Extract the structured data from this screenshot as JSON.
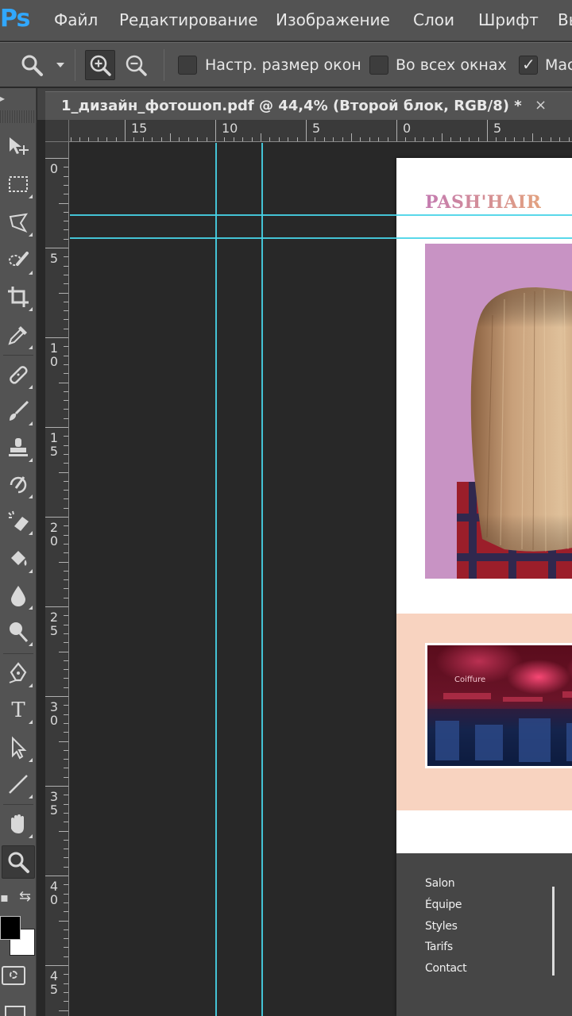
{
  "app": {
    "logo": "Ps",
    "brand_color": "#31a8ff"
  },
  "menu": {
    "items": [
      "Файл",
      "Редактирование",
      "Изображение",
      "Слои",
      "Шрифт",
      "Вы"
    ]
  },
  "options_bar": {
    "tool_icon": "zoom-icon",
    "checkboxes": [
      {
        "label": "Настр. размер окон",
        "checked": false
      },
      {
        "label": "Во всех окнах",
        "checked": false
      },
      {
        "label": "Мас",
        "checked": true
      }
    ]
  },
  "document": {
    "tab_title": "1_дизайн_фотошоп.pdf @ 44,4% (Второй блок, RGB/8) *",
    "close_glyph": "×"
  },
  "rulers": {
    "horizontal_labels": [
      "15",
      "10",
      "5",
      "0",
      "5"
    ],
    "vertical_labels": [
      [
        "0"
      ],
      [
        "5"
      ],
      [
        "1",
        "0"
      ],
      [
        "1",
        "5"
      ],
      [
        "2",
        "0"
      ],
      [
        "2",
        "5"
      ],
      [
        "3",
        "0"
      ],
      [
        "3",
        "5"
      ],
      [
        "4",
        "0"
      ],
      [
        "4",
        "5"
      ]
    ]
  },
  "artboard": {
    "brand": "PASH'HAIR",
    "brand_gradient": [
      "#c47bb0",
      "#e3a27f"
    ],
    "hero_bg": "#c893c4",
    "salon_band_bg": "#f8d3c0",
    "salon_photo_text": "Coiffure",
    "footer_bg": "#464646",
    "footer_links": [
      "Salon",
      "Équipe",
      "Styles",
      "Tarifs",
      "Contact"
    ]
  },
  "guide_color": "#47d4e8",
  "colors": {
    "foreground": "#000000",
    "background": "#ffffff"
  }
}
